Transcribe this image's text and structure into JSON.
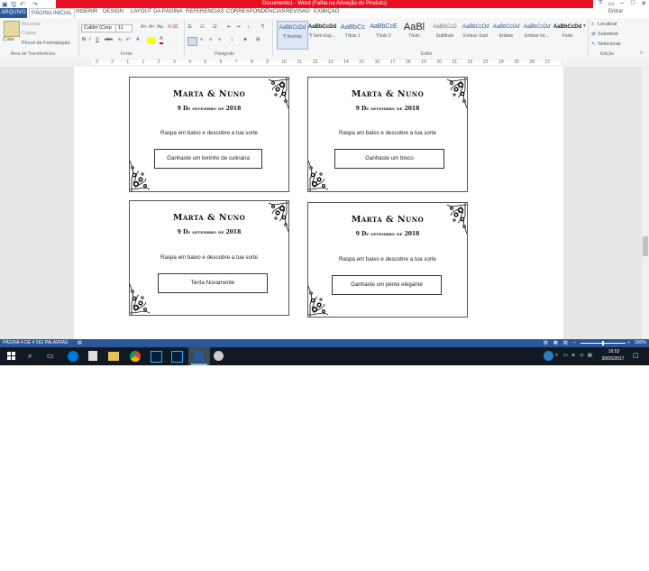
{
  "window": {
    "title": "Documento1 - Word (Falha na Ativação do Produto)",
    "account": "Entrar",
    "help": "?"
  },
  "tabs": [
    "ARQUIVO",
    "PÁGINA INICIAL",
    "INSERIR",
    "DESIGN",
    "LAYOUT DA PÁGINA",
    "REFERÊNCIAS",
    "CORRESPONDÊNCIAS",
    "REVISÃO",
    "EXIBIÇÃO"
  ],
  "clipboard": {
    "paste": "Colar",
    "cut": "Recortar",
    "copy": "Copiar",
    "format_painter": "Pincel de Formatação",
    "group": "Área de Transferência"
  },
  "font": {
    "name": "Calibri (Corp",
    "size": "11",
    "group": "Fonte"
  },
  "paragraph": {
    "group": "Parágrafo"
  },
  "styles": {
    "group": "Estilo",
    "items": [
      {
        "sample": "AaBbCcDd",
        "label": "¶ Normal"
      },
      {
        "sample": "AaBbCcDd",
        "label": "¶ Sem Esp..."
      },
      {
        "sample": "AaBbCc",
        "label": "Título 1"
      },
      {
        "sample": "AaBbCcE",
        "label": "Título 2"
      },
      {
        "sample": "AaBl",
        "label": "Título"
      },
      {
        "sample": "AaBbCcD",
        "label": "Subtítulo"
      },
      {
        "sample": "AaBbCcDd",
        "label": "Ênfase Sutil"
      },
      {
        "sample": "AaBbCcDd",
        "label": "Ênfase"
      },
      {
        "sample": "AaBbCcDd",
        "label": "Ênfase Int..."
      },
      {
        "sample": "AaBbCcDd",
        "label": "Forte"
      }
    ]
  },
  "editing": {
    "find": "Localizar",
    "replace": "Substituir",
    "select": "Selecionar",
    "group": "Edição"
  },
  "ruler": [
    "3",
    "2",
    "1",
    "1",
    "2",
    "3",
    "4",
    "5",
    "6",
    "7",
    "8",
    "9",
    "10",
    "11",
    "12",
    "13",
    "14",
    "15",
    "16",
    "17",
    "18",
    "19",
    "20",
    "21",
    "22",
    "23",
    "24",
    "25",
    "26",
    "27"
  ],
  "cards": [
    {
      "title": "Marta & Nuno",
      "date": "9 De setembro de 2018",
      "instruction": "Raspa em baixo e descobre a tua sorte",
      "prize": "Ganhaste um livrinho de culinária"
    },
    {
      "title": "Marta & Nuno",
      "date": "9 De setembro de 2018",
      "instruction": "Raspa em baixo e descobre a tua sorte",
      "prize": "Ganhaste um bloco"
    },
    {
      "title": "Marta & Nuno",
      "date": "9 De setembro de 2018",
      "instruction": "Raspa em baixo e descobre a tua sorte",
      "prize": "Tenta Novamente"
    },
    {
      "title": "Marta & Nuno",
      "date": "9 De setembro de 2018",
      "instruction": "Raspa em baixo e descobre a tua sorte",
      "prize": "Ganhaste um pente elegante"
    }
  ],
  "status": {
    "page": "PÁGINA 4 DE 4",
    "words": "561 PALAVRAS",
    "zoom": "100%"
  },
  "taskbar": {
    "time": "16:53",
    "date": "30/05/2017"
  },
  "colors": {
    "accent": "#2b579a",
    "title_bar": "#e81123",
    "taskbar": "#111a23"
  }
}
